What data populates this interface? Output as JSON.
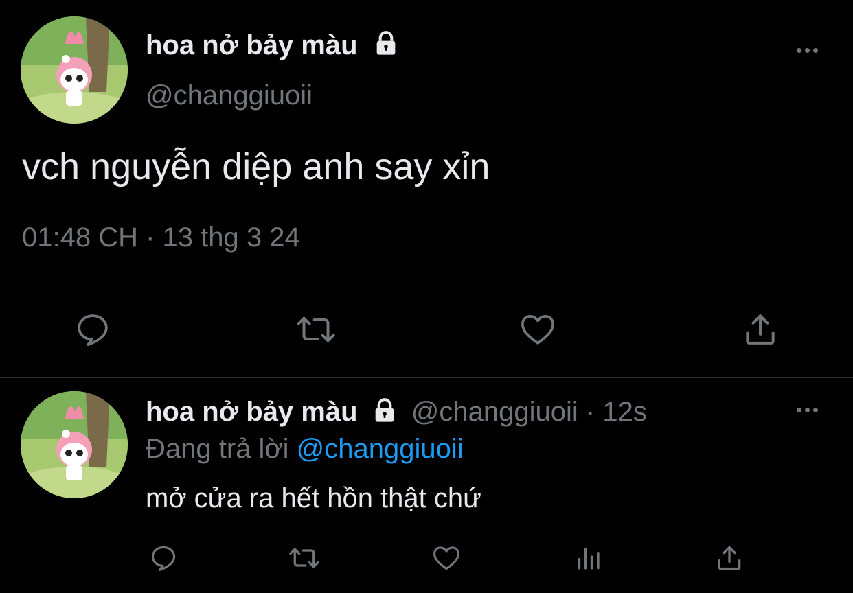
{
  "main_tweet": {
    "display_name": "hoa nở bảy màu",
    "handle": "@changgiuoii",
    "text": "vch nguyễn diệp anh say xỉn",
    "timestamp": "01:48 CH · 13 thg 3 24",
    "icons": [
      "lock-icon",
      "more-icon",
      "reply-icon",
      "retweet-icon",
      "like-icon",
      "share-icon"
    ]
  },
  "reply_tweet": {
    "display_name": "hoa nở bảy màu",
    "handle": "@changgiuoii",
    "separator": "·",
    "time_ago": "12s",
    "replying_label": "Đang trả lời",
    "replying_to": "@changgiuoii",
    "text": "mở cửa ra hết hồn thật chứ",
    "icons": [
      "lock-icon",
      "more-icon",
      "reply-icon",
      "retweet-icon",
      "like-icon",
      "analytics-icon",
      "share-icon"
    ]
  },
  "colors": {
    "background": "#000000",
    "text": "#e7e9ea",
    "muted": "#71767b",
    "link": "#1d9bf0",
    "divider": "#2f3336"
  }
}
